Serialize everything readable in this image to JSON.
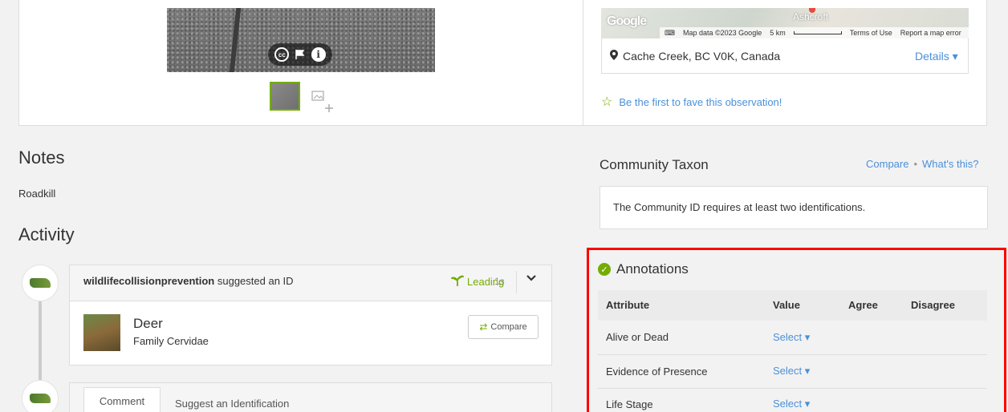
{
  "map": {
    "google_label": "Google",
    "town": "Ashcroft",
    "attribution": {
      "map_data": "Map data ©2023 Google",
      "scale": "5 km",
      "terms": "Terms of Use",
      "report": "Report a map error"
    }
  },
  "location": {
    "place": "Cache Creek, BC V0K, Canada",
    "details_label": "Details ▾"
  },
  "fave": {
    "label": "Be the first to fave this observation!"
  },
  "notes": {
    "heading": "Notes",
    "text": "Roadkill"
  },
  "activity": {
    "heading": "Activity",
    "identification": {
      "user": "wildlifecollisionprevention",
      "action": " suggested an ID",
      "status": "Leading",
      "time": "1s",
      "taxon_name": "Deer",
      "taxon_rank": "Family Cervidae",
      "compare_label": "Compare"
    },
    "tabs": {
      "comment": "Comment",
      "suggest": "Suggest an Identification"
    }
  },
  "community_taxon": {
    "heading": "Community Taxon",
    "compare_link": "Compare",
    "whats_this_link": "What's this?",
    "message": "The Community ID requires at least two identifications."
  },
  "annotations": {
    "heading": "Annotations",
    "columns": {
      "attribute": "Attribute",
      "value": "Value",
      "agree": "Agree",
      "disagree": "Disagree"
    },
    "rows": [
      {
        "attribute": "Alive or Dead",
        "value": "Select ▾"
      },
      {
        "attribute": "Evidence of Presence",
        "value": "Select ▾"
      },
      {
        "attribute": "Life Stage",
        "value": "Select ▾"
      }
    ]
  },
  "colors": {
    "accent_green": "#74ac00",
    "link_blue": "#4a90d9",
    "highlight_red": "#ff0000"
  }
}
